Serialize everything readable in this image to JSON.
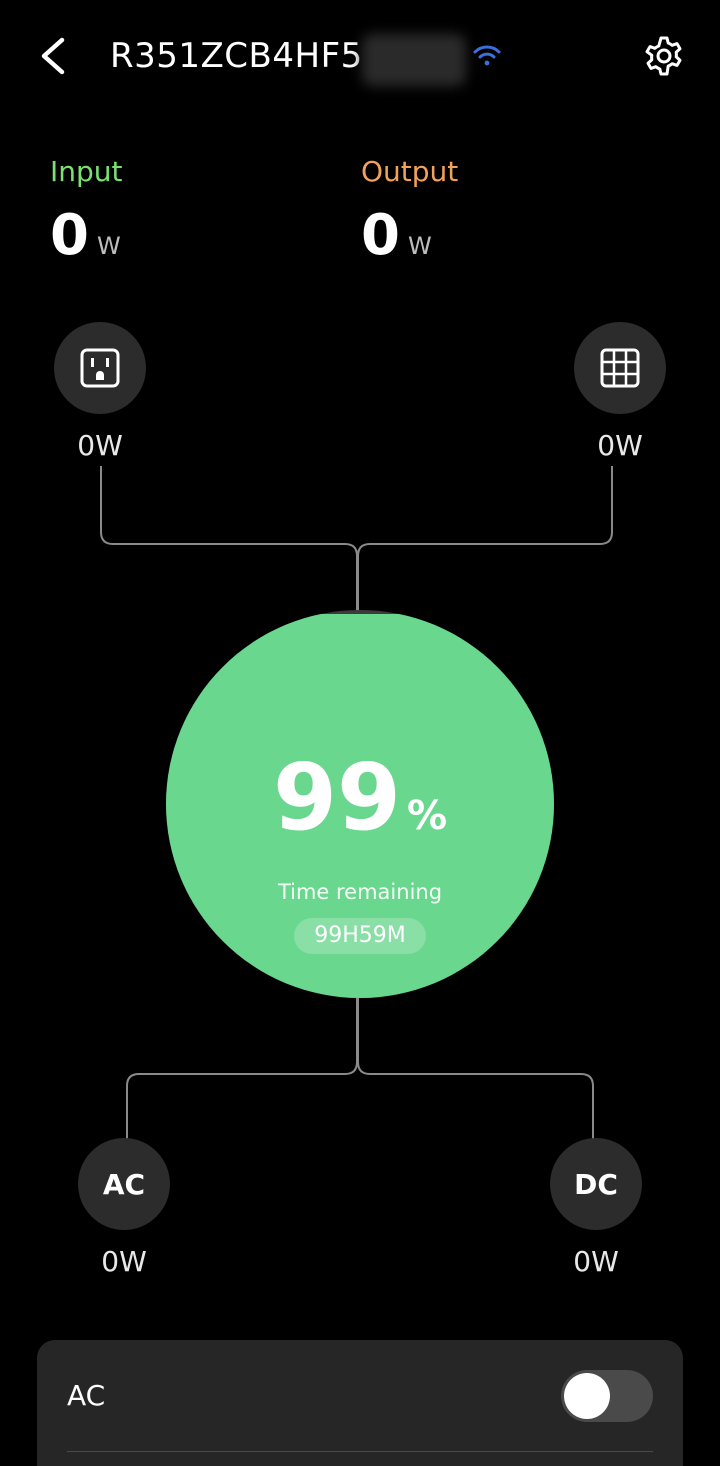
{
  "header": {
    "device_name": "R351ZCB4HF5",
    "back_icon": "chevron-left-icon",
    "wifi_icon": "wifi-icon",
    "wifi_color": "#3b6fd9",
    "settings_icon": "gear-icon"
  },
  "summary": {
    "input_label": "Input",
    "input_value": "0",
    "input_unit": "W",
    "input_color": "#7be06e",
    "output_label": "Output",
    "output_value": "0",
    "output_unit": "W",
    "output_color": "#f0a25a"
  },
  "sources": {
    "ac_input": {
      "icon": "power-outlet-icon",
      "value": "0W"
    },
    "solar_input": {
      "icon": "solar-panel-icon",
      "value": "0W"
    }
  },
  "battery": {
    "percent": "99",
    "percent_unit": "%",
    "level": 0.99,
    "fill_color": "#69d78e",
    "remaining_label": "Time remaining",
    "remaining_value": "99H59M"
  },
  "outputs": {
    "ac": {
      "label": "AC",
      "value": "0W"
    },
    "dc": {
      "label": "DC",
      "value": "0W"
    }
  },
  "controls": {
    "ac_label": "AC",
    "ac_enabled": false
  }
}
